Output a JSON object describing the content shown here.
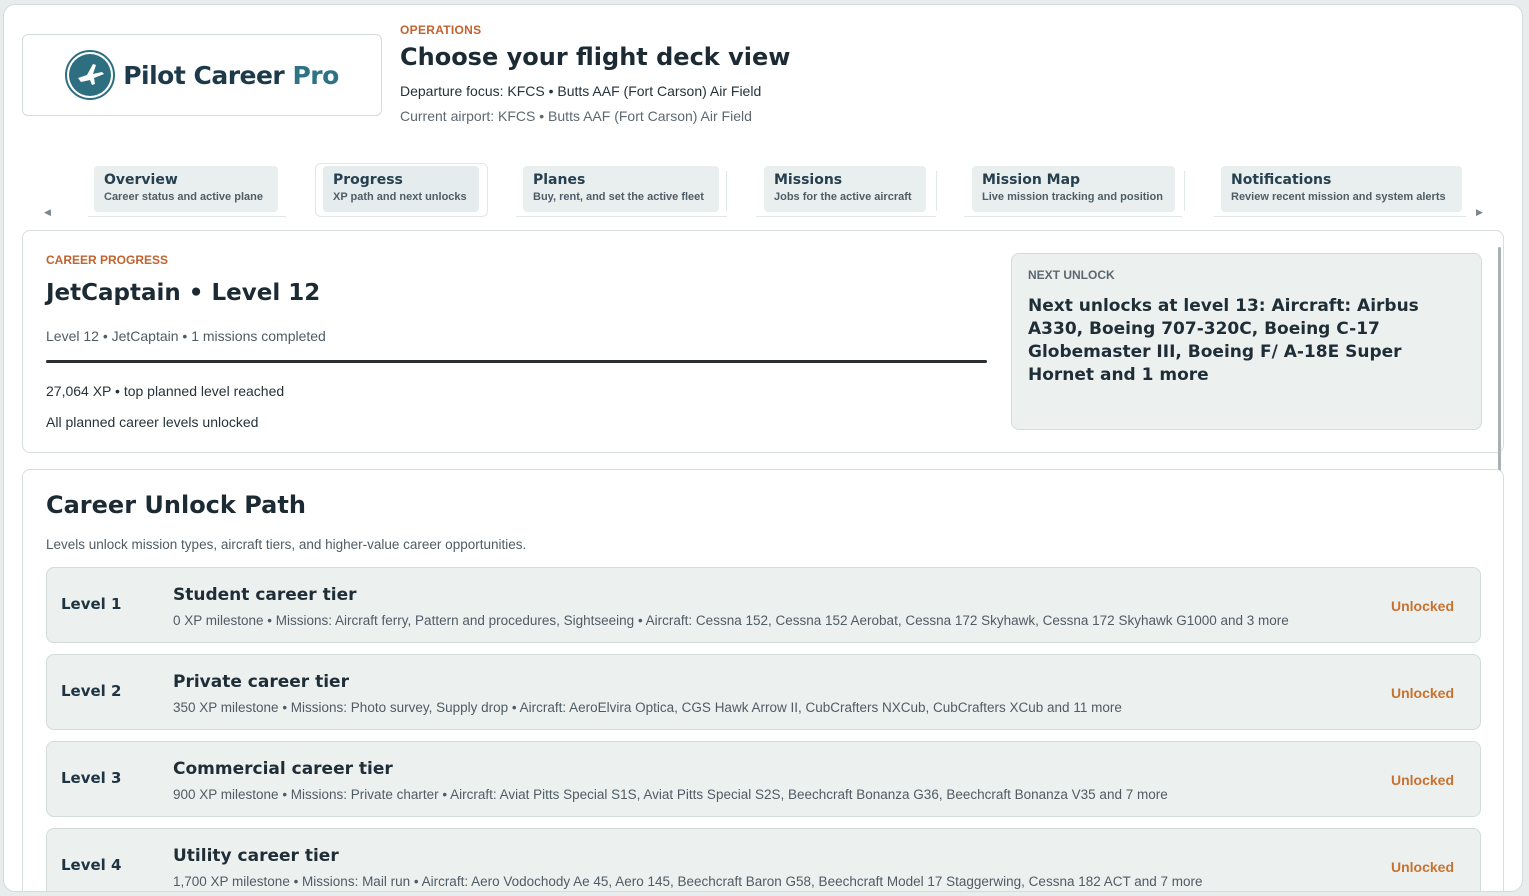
{
  "brand": {
    "name_main": "Pilot Career",
    "name_accent": "Pro"
  },
  "header": {
    "eyebrow": "OPERATIONS",
    "title": "Choose your flight deck view",
    "departure": "Departure focus: KFCS • Butts AAF (Fort Carson) Air Field",
    "current": "Current airport: KFCS • Butts AAF (Fort Carson) Air Field"
  },
  "tabs": [
    {
      "label": "Overview",
      "sub": "Career status and active plane"
    },
    {
      "label": "Progress",
      "sub": "XP path and next unlocks"
    },
    {
      "label": "Planes",
      "sub": "Buy, rent, and set the active fleet"
    },
    {
      "label": "Missions",
      "sub": "Jobs for the active aircraft"
    },
    {
      "label": "Mission Map",
      "sub": "Live mission tracking and position"
    },
    {
      "label": "Notifications",
      "sub": "Review recent mission and system alerts"
    }
  ],
  "active_tab": "Progress",
  "progress": {
    "eyebrow": "CAREER PROGRESS",
    "title": "JetCaptain • Level 12",
    "sub": "Level 12 • JetCaptain • 1 missions completed",
    "bar_fraction": 1.0,
    "xp_line": "27,064 XP • top planned level reached",
    "all_line": "All planned career levels unlocked"
  },
  "next_unlock": {
    "eyebrow": "NEXT UNLOCK",
    "text": "Next unlocks at level 13: Aircraft: Airbus A330, Boeing 707-320C, Boeing C-17 Globemaster III, Boeing F/ A-18E Super Hornet and 1 more"
  },
  "path": {
    "title": "Career Unlock Path",
    "sub": "Levels unlock mission types, aircraft tiers, and higher-value career opportunities.",
    "levels": [
      {
        "level": "Level 1",
        "name": "Student career tier",
        "desc": "0 XP milestone • Missions: Aircraft ferry, Pattern and procedures, Sightseeing • Aircraft: Cessna 152, Cessna 152 Aerobat, Cessna 172 Skyhawk, Cessna 172 Skyhawk G1000 and 3 more",
        "status": "Unlocked"
      },
      {
        "level": "Level 2",
        "name": "Private career tier",
        "desc": "350 XP milestone • Missions: Photo survey, Supply drop • Aircraft: AeroElvira Optica, CGS Hawk Arrow II, CubCrafters NXCub, CubCrafters XCub and 11 more",
        "status": "Unlocked"
      },
      {
        "level": "Level 3",
        "name": "Commercial career tier",
        "desc": "900 XP milestone • Missions: Private charter • Aircraft: Aviat Pitts Special S1S, Aviat Pitts Special S2S, Beechcraft Bonanza G36, Beechcraft Bonanza V35 and 7 more",
        "status": "Unlocked"
      },
      {
        "level": "Level 4",
        "name": "Utility career tier",
        "desc": "1,700 XP milestone • Missions: Mail run • Aircraft: Aero Vodochody Ae 45, Aero 145, Beechcraft Baron G58, Beechcraft Model 17 Staggerwing, Cessna 182 ACT and 7 more",
        "status": "Unlocked"
      }
    ]
  },
  "colors": {
    "accent": "#c0632e",
    "panel_bg": "#ecf1f0",
    "brand_teal": "#2d7384"
  }
}
